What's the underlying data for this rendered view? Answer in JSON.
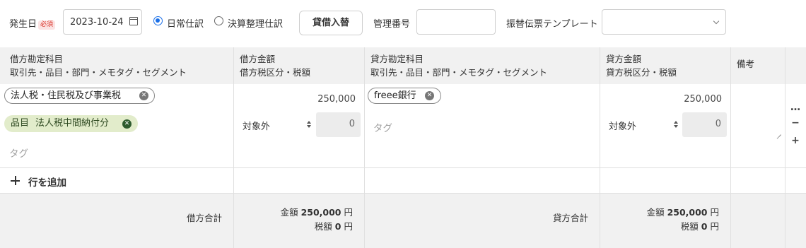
{
  "toolbar": {
    "issue_date_label": "発生日",
    "required_badge": "必須",
    "issue_date_value": "2023-10-24",
    "radio_normal_label": "日常仕訳",
    "radio_settlement_label": "決算整理仕訳",
    "swap_button_label": "貸借入替",
    "management_no_label": "管理番号",
    "management_no_value": "",
    "template_label": "振替伝票テンプレート",
    "template_value": ""
  },
  "columns": {
    "debit_account": {
      "line1": "借方勘定科目",
      "line2": "取引先・品目・部門・メモタグ・セグメント"
    },
    "debit_amount": {
      "line1": "借方金額",
      "line2": "借方税区分・税額"
    },
    "credit_account": {
      "line1": "貸方勘定科目",
      "line2": "取引先・品目・部門・メモタグ・セグメント"
    },
    "credit_amount": {
      "line1": "貸方金額",
      "line2": "貸方税区分・税額"
    },
    "memo": {
      "line1": "備考"
    }
  },
  "rows": [
    {
      "debit": {
        "account_tag": "法人税・住民税及び事業税",
        "item_chip_prefix": "品目",
        "item_chip_value": "法人税中間納付分",
        "tag_placeholder": "タグ",
        "amount": "250,000",
        "tax_category": "対象外",
        "tax_amount": "0"
      },
      "credit": {
        "account_tag": "freee銀行",
        "tag_placeholder": "タグ",
        "amount": "250,000",
        "tax_category": "対象外",
        "tax_amount": "0"
      },
      "memo": ""
    }
  ],
  "row_controls": {
    "more": "…",
    "remove": "−",
    "add": "+"
  },
  "add_row_label": "行を追加",
  "totals": {
    "debit_label": "借方合計",
    "credit_label": "貸方合計",
    "amount_prefix": "金額",
    "tax_prefix": "税額",
    "currency_suffix": "円",
    "debit_amount": "250,000",
    "debit_tax": "0",
    "credit_amount": "250,000",
    "credit_tax": "0"
  },
  "colors": {
    "accent": "#1a6fe8",
    "required": "#d93025",
    "chip_green": "#e2eccb",
    "header_bg": "#f1f1f1"
  }
}
